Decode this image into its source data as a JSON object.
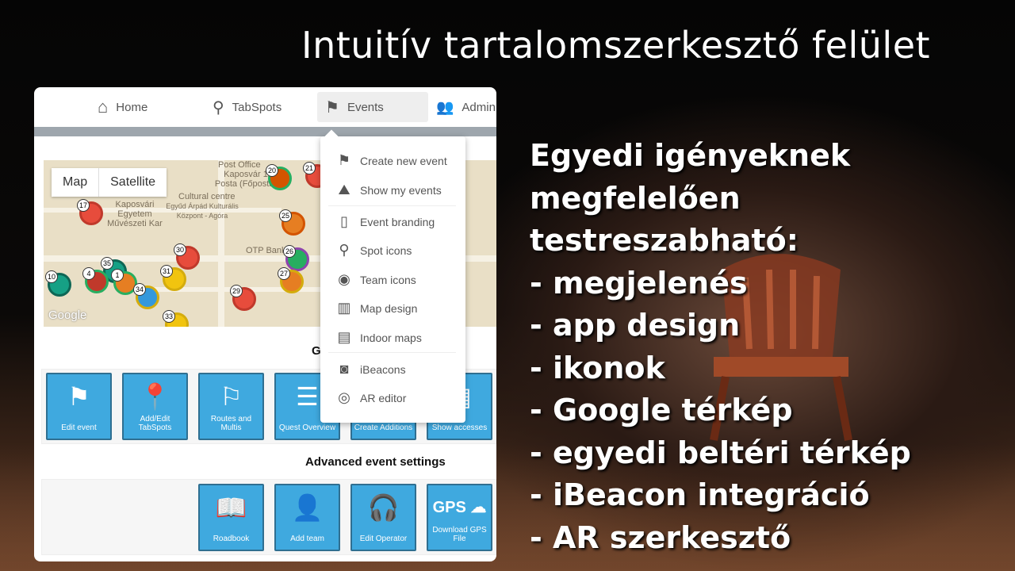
{
  "slide": {
    "title": "Intuitív tartalomszerkesztő felület",
    "bullets": [
      "Egyedi igényeknek",
      "megfelelően  testreszabható:",
      "- megjelenés",
      "- app design",
      "- ikonok",
      "- Google térkép",
      "- egyedi beltéri térkép",
      "- iBeacon integráció",
      "- AR szerkesztő"
    ]
  },
  "nav": [
    {
      "label": "Home",
      "icon": "home-icon"
    },
    {
      "label": "TabSpots",
      "icon": "map-pin-icon"
    },
    {
      "label": "Events",
      "icon": "flag-icon",
      "active": true
    },
    {
      "label": "Admin",
      "icon": "users-icon"
    }
  ],
  "map": {
    "types": [
      "Map",
      "Satellite"
    ],
    "labels": [
      "Post Office",
      "Kaposvár 1 Posta (Főposta)",
      "Cultural centre",
      "Egyűd Árpád Kulturális Központ - Agóra",
      "Kaposvári Egyetem Művészeti Kar",
      "OTP Bank",
      "Google"
    ],
    "markers": [
      "17",
      "20",
      "21",
      "25",
      "30",
      "26",
      "35",
      "1",
      "4",
      "10",
      "31",
      "29",
      "34",
      "27",
      "33"
    ]
  },
  "general_heading": "G",
  "general_tiles": [
    "Edit event",
    "Add/Edit TabSpots",
    "Routes and Multis",
    "Quest Overview",
    "Create Additions",
    "Show accesses"
  ],
  "advanced_heading": "Advanced event settings",
  "advanced_tiles": [
    "Roadbook",
    "Add team",
    "Edit Operator",
    "Download GPS File"
  ],
  "dropdown": [
    "Create new event",
    "Show my events",
    "Event branding",
    "Spot icons",
    "Team icons",
    "Map design",
    "Indoor maps",
    "iBeacons",
    "AR editor"
  ],
  "colors": {
    "tile": "#3fa9df",
    "graybar": "#9ea6ad"
  }
}
